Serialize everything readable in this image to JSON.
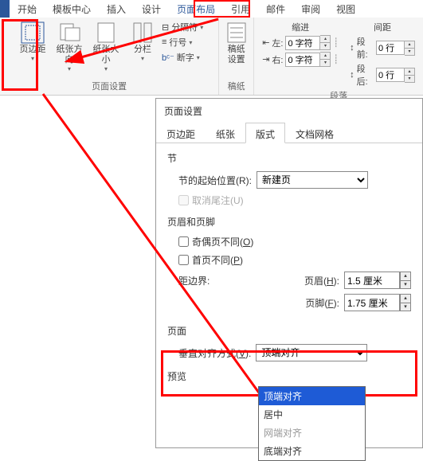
{
  "menu": [
    "开始",
    "模板中心",
    "插入",
    "设计",
    "页面布局",
    "引用",
    "邮件",
    "审阅",
    "视图"
  ],
  "menu_active_index": 4,
  "ribbon": {
    "page_setup": {
      "margin": "页边距",
      "orientation": "纸张方向",
      "size": "纸张大小",
      "columns": "分栏",
      "breaks": "分隔符",
      "lineno": "行号",
      "hyphen": "断字",
      "group_label": "页面设置"
    },
    "manuscript": {
      "btn": "稿纸\n设置",
      "label": "稿纸"
    },
    "indent": {
      "head": "缩进",
      "left_lbl": "左:",
      "left_val": "0 字符",
      "right_lbl": "右:",
      "right_val": "0 字符"
    },
    "spacing": {
      "head": "间距",
      "before_lbl": "段前:",
      "before_val": "0 行",
      "after_lbl": "段后:",
      "after_val": "0 行",
      "group_label": "段落"
    }
  },
  "dialog": {
    "title": "页面设置",
    "tabs": [
      "页边距",
      "纸张",
      "版式",
      "文档网格"
    ],
    "active_tab": 2,
    "section": {
      "head": "节",
      "start_lbl": "节的起始位置(R):",
      "start_val": "新建页",
      "suppress": "取消尾注(U)"
    },
    "hf": {
      "head": "页眉和页脚",
      "odd_even": "奇偶页不同(O)",
      "first_diff": "首页不同(P)",
      "edge_lbl": "距边界:",
      "header_lbl": "页眉(H):",
      "header_val": "1.5 厘米",
      "footer_lbl": "页脚(F):",
      "footer_val": "1.75 厘米"
    },
    "page": {
      "head": "页面",
      "valign_lbl": "垂直对齐方式(V):",
      "valign_val": "顶端对齐",
      "options": [
        "顶端对齐",
        "居中",
        "网端对齐",
        "底端对齐"
      ]
    },
    "preview": "预览"
  }
}
